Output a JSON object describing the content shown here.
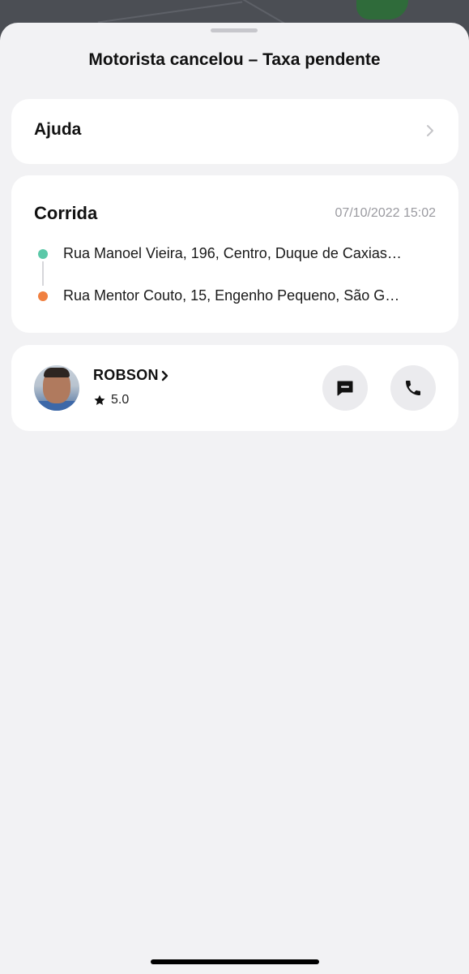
{
  "sheet": {
    "title": "Motorista cancelou – Taxa pendente"
  },
  "help": {
    "label": "Ajuda",
    "chevron_icon": "chevron-right-icon"
  },
  "ride": {
    "title": "Corrida",
    "datetime": "07/10/2022 15:02",
    "origin": "Rua Manoel Vieira, 196, Centro, Duque de Caxias…",
    "destination": "Rua Mentor Couto, 15, Engenho Pequeno, São G…",
    "origin_color": "#5bc8a8",
    "destination_color": "#f08040"
  },
  "driver": {
    "name": "ROBSON",
    "rating": "5.0",
    "rating_icon": "star-icon",
    "message_icon": "message-icon",
    "call_icon": "phone-icon"
  }
}
